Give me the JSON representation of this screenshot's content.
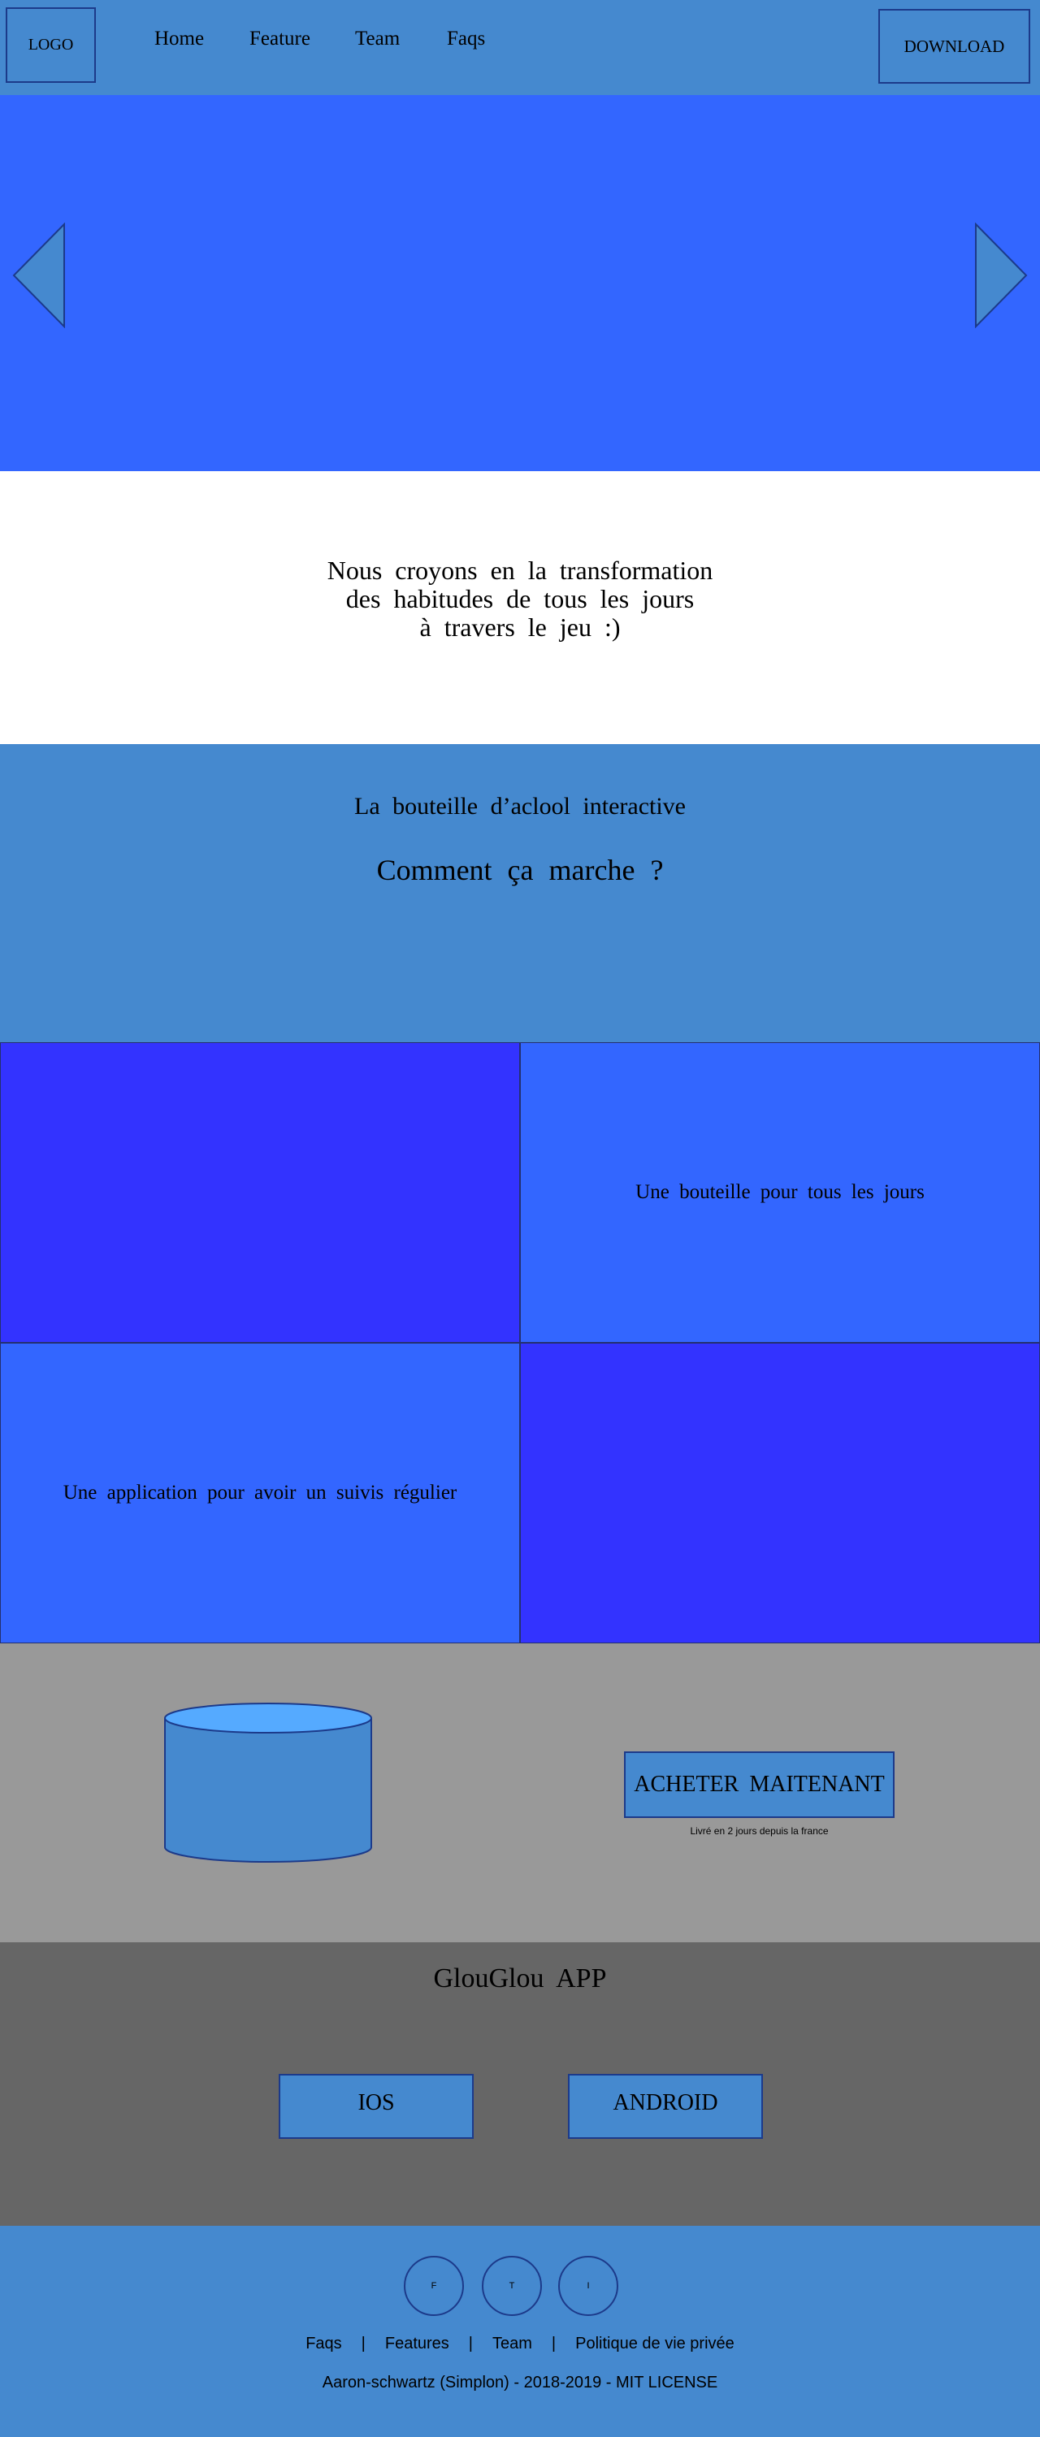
{
  "header": {
    "logo": "LOGO",
    "nav": [
      {
        "label": "Home"
      },
      {
        "label": "Feature"
      },
      {
        "label": "Team"
      },
      {
        "label": "Faqs"
      }
    ],
    "download": "DOWNLOAD"
  },
  "hero": {
    "prev_icon": "triangle-left-icon",
    "next_icon": "triangle-right-icon"
  },
  "intro": {
    "lines": [
      "Nous croyons en la transformation",
      "des habitudes de tous les jours",
      "à travers le jeu :)"
    ]
  },
  "how": {
    "title": "La bouteille d’aclool interactive",
    "subtitle": "Comment ça marche ?"
  },
  "features": {
    "bottle_text": "Une bouteille pour tous les jours",
    "app_text": "Une application pour avoir un suivis régulier"
  },
  "buy": {
    "button": "ACHETER MAITENANT",
    "note": "Livré en 2 jours depuis la france"
  },
  "app": {
    "title": "GlouGlou APP",
    "ios": "IOS",
    "android": "ANDROID"
  },
  "footer": {
    "social": [
      {
        "label": "F"
      },
      {
        "label": "T"
      },
      {
        "label": "I"
      }
    ],
    "links": [
      {
        "label": "Faqs"
      },
      {
        "label": "Features"
      },
      {
        "label": "Team"
      },
      {
        "label": "Politique de vie privée"
      }
    ],
    "separator": "|",
    "copyright": "Aaron-schwartz (Simplon) - 2018-2019 - MIT LICENSE"
  },
  "colors": {
    "header_bg": "#4589cf",
    "hero_bg": "#3366ff",
    "feature_dark": "#3333ff",
    "feature_light": "#3366ff",
    "buy_bg": "#999999",
    "app_bg": "#666666",
    "footer_bg": "#4589cf",
    "outline": "#1c3a8a"
  }
}
